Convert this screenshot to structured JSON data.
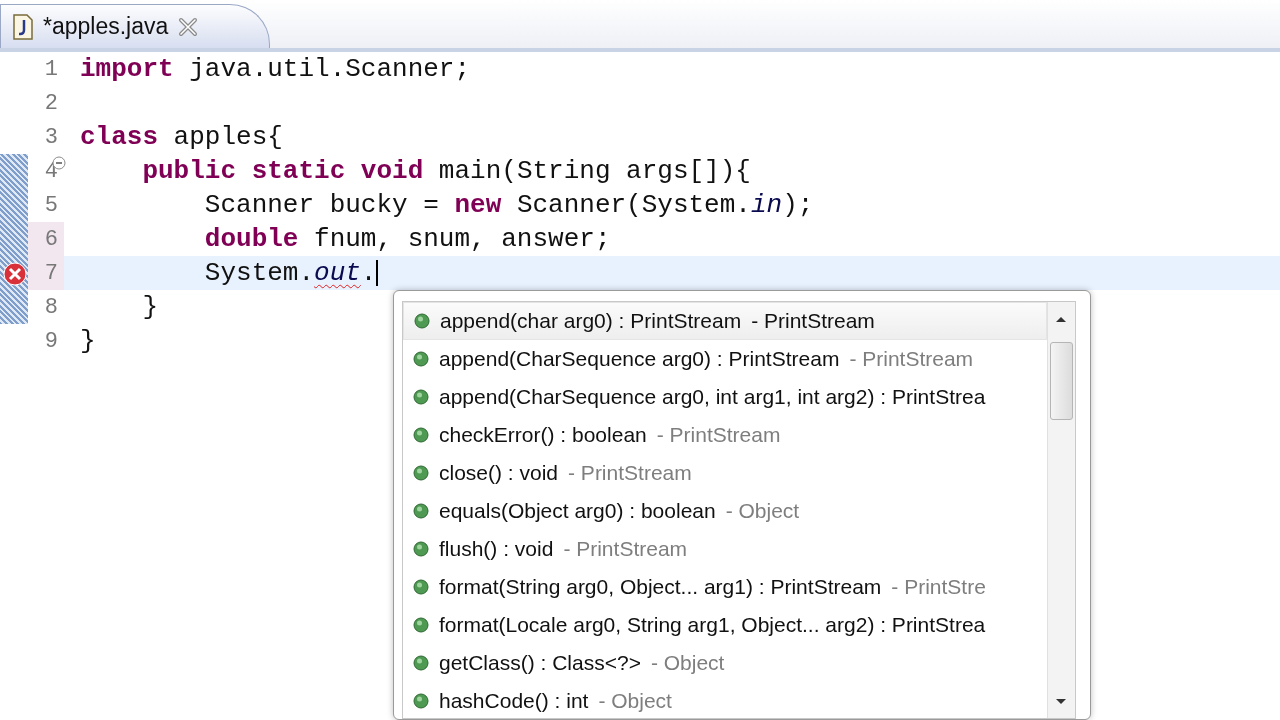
{
  "editor_tab": {
    "title": "*apples.java"
  },
  "code_lines": [
    {
      "number": "1",
      "range": false,
      "marked": false,
      "current": false,
      "fold": false,
      "error": false,
      "tokens": [
        {
          "kind": "keyword",
          "text": "import"
        },
        {
          "kind": "plain",
          "text": " java.util.Scanner;"
        }
      ]
    },
    {
      "number": "2",
      "range": false,
      "marked": false,
      "current": false,
      "fold": false,
      "error": false
    },
    {
      "number": "3",
      "range": false,
      "marked": false,
      "current": false,
      "fold": false,
      "error": false,
      "tokens": [
        {
          "kind": "keyword",
          "text": "class"
        },
        {
          "kind": "plain",
          "text": " apples{"
        }
      ]
    },
    {
      "number": "4",
      "range": true,
      "marked": false,
      "current": false,
      "fold": true,
      "error": false,
      "tokens": [
        {
          "kind": "keyword",
          "text": "    public static void"
        },
        {
          "kind": "plain",
          "text": " main(String args[]){"
        }
      ]
    },
    {
      "number": "5",
      "range": true,
      "marked": false,
      "current": false,
      "fold": false,
      "error": false,
      "tokens": [
        {
          "kind": "plain",
          "text": "        Scanner bucky = "
        },
        {
          "kind": "keyword",
          "text": "new"
        },
        {
          "kind": "plain",
          "text": " Scanner(System."
        },
        {
          "kind": "field",
          "text": "in"
        },
        {
          "kind": "plain",
          "text": ");"
        }
      ]
    },
    {
      "number": "6",
      "range": true,
      "marked": true,
      "current": false,
      "fold": false,
      "error": false,
      "tokens": [
        {
          "kind": "keyword",
          "text": "        double"
        },
        {
          "kind": "plain",
          "text": " fnum, snum, answer;"
        }
      ]
    },
    {
      "number": "7",
      "range": true,
      "marked": true,
      "current": true,
      "fold": false,
      "error": true,
      "tokens": [
        {
          "kind": "plain",
          "text": "        System."
        },
        {
          "kind": "field-error",
          "text": "out"
        },
        {
          "kind": "plain",
          "text": "."
        },
        {
          "kind": "caret"
        }
      ]
    },
    {
      "number": "8",
      "range": true,
      "marked": false,
      "current": false,
      "fold": false,
      "error": false,
      "tokens": [
        {
          "kind": "plain",
          "text": "    }"
        }
      ]
    },
    {
      "number": "9",
      "range": false,
      "marked": false,
      "current": false,
      "fold": false,
      "error": false,
      "tokens": [
        {
          "kind": "plain",
          "text": "}"
        }
      ]
    }
  ],
  "proposals": [
    {
      "signature": "append(char arg0) : PrintStream",
      "owner": "- PrintStream",
      "selected": true
    },
    {
      "signature": "append(CharSequence arg0) : PrintStream",
      "owner": "- PrintStream",
      "selected": false
    },
    {
      "signature": "append(CharSequence arg0, int arg1, int arg2) : PrintStrea",
      "selected": false
    },
    {
      "signature": "checkError() : boolean",
      "owner": "- PrintStream",
      "selected": false
    },
    {
      "signature": "close() : void",
      "owner": "- PrintStream",
      "selected": false
    },
    {
      "signature": "equals(Object arg0) : boolean",
      "owner": "- Object",
      "selected": false
    },
    {
      "signature": "flush() : void",
      "owner": "- PrintStream",
      "selected": false
    },
    {
      "signature": "format(String arg0, Object... arg1) : PrintStream",
      "owner": "- PrintStre",
      "selected": false
    },
    {
      "signature": "format(Locale arg0, String arg1, Object... arg2) : PrintStrea",
      "selected": false
    },
    {
      "signature": "getClass() : Class<?>",
      "owner": "- Object",
      "selected": false
    },
    {
      "signature": "hashCode() : int",
      "owner": "- Object",
      "selected": false
    }
  ]
}
